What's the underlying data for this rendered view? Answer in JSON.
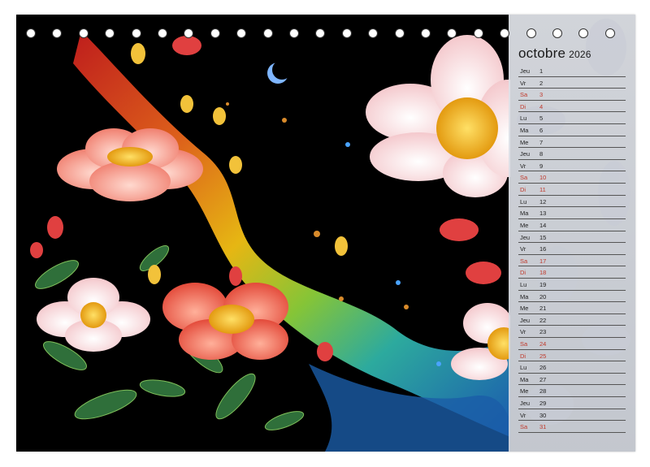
{
  "calendar": {
    "month": "octobre",
    "year": "2026",
    "days": [
      {
        "dn": "Jeu",
        "d": "1",
        "we": false
      },
      {
        "dn": "Vr",
        "d": "2",
        "we": false
      },
      {
        "dn": "Sa",
        "d": "3",
        "we": true
      },
      {
        "dn": "Di",
        "d": "4",
        "we": true
      },
      {
        "dn": "Lu",
        "d": "5",
        "we": false
      },
      {
        "dn": "Ma",
        "d": "6",
        "we": false
      },
      {
        "dn": "Me",
        "d": "7",
        "we": false
      },
      {
        "dn": "Jeu",
        "d": "8",
        "we": false
      },
      {
        "dn": "Vr",
        "d": "9",
        "we": false
      },
      {
        "dn": "Sa",
        "d": "10",
        "we": true
      },
      {
        "dn": "Di",
        "d": "11",
        "we": true
      },
      {
        "dn": "Lu",
        "d": "12",
        "we": false
      },
      {
        "dn": "Ma",
        "d": "13",
        "we": false
      },
      {
        "dn": "Me",
        "d": "14",
        "we": false
      },
      {
        "dn": "Jeu",
        "d": "15",
        "we": false
      },
      {
        "dn": "Vr",
        "d": "16",
        "we": false
      },
      {
        "dn": "Sa",
        "d": "17",
        "we": true
      },
      {
        "dn": "Di",
        "d": "18",
        "we": true
      },
      {
        "dn": "Lu",
        "d": "19",
        "we": false
      },
      {
        "dn": "Ma",
        "d": "20",
        "we": false
      },
      {
        "dn": "Me",
        "d": "21",
        "we": false
      },
      {
        "dn": "Jeu",
        "d": "22",
        "we": false
      },
      {
        "dn": "Vr",
        "d": "23",
        "we": false
      },
      {
        "dn": "Sa",
        "d": "24",
        "we": true
      },
      {
        "dn": "Di",
        "d": "25",
        "we": true
      },
      {
        "dn": "Lu",
        "d": "26",
        "we": false
      },
      {
        "dn": "Ma",
        "d": "27",
        "we": false
      },
      {
        "dn": "Me",
        "d": "28",
        "we": false
      },
      {
        "dn": "Jeu",
        "d": "29",
        "we": false
      },
      {
        "dn": "Vr",
        "d": "30",
        "we": false
      },
      {
        "dn": "Sa",
        "d": "31",
        "we": true
      }
    ]
  },
  "colors": {
    "weekend": "#c0392b",
    "background": "#000000",
    "panel": "#dfe2e8"
  }
}
